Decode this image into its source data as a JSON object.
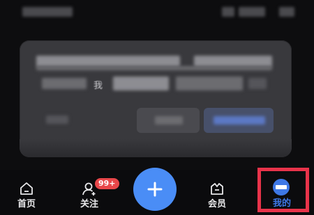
{
  "dialog": {
    "partial_text": "我"
  },
  "tabbar": {
    "tabs": [
      {
        "label": "首页",
        "icon": "home-icon"
      },
      {
        "label": "关注",
        "icon": "follow-icon",
        "badge": "99+"
      },
      {
        "icon": "plus-icon"
      },
      {
        "label": "会员",
        "icon": "membership-icon"
      },
      {
        "label": "我的",
        "icon": "profile-avatar-icon",
        "active": true
      }
    ]
  },
  "colors": {
    "accent_blue": "#4a8df6",
    "badge_red": "#e8474a",
    "highlight_red": "#e8334a"
  }
}
